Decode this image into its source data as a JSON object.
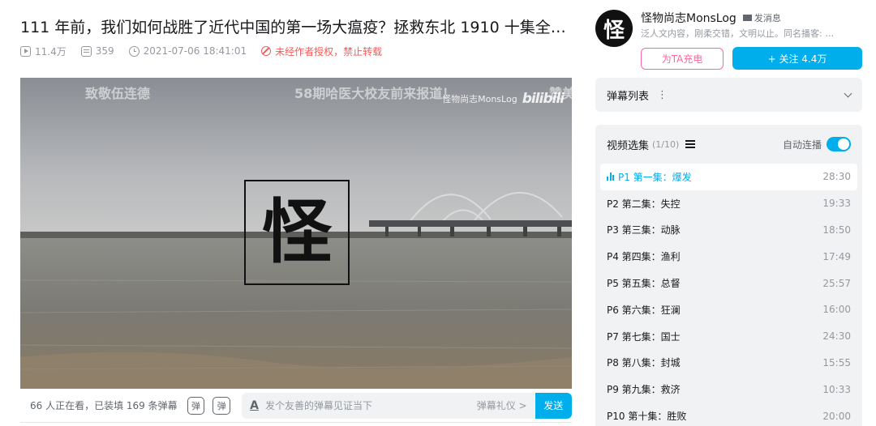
{
  "video": {
    "title": "111 年前，我们如何战胜了近代中国的第一场大瘟疫？拯救东北 1910 十集全【…",
    "views": "11.4万",
    "danmaku_count": "359",
    "publish_time": "2021-07-06 18:41:01",
    "copyright_notice": "未经作者授权，禁止转载"
  },
  "player": {
    "overlay_danmaku": [
      "致敬伍连德",
      "58期哈医大校友前来报道！",
      "赞美"
    ],
    "watermark_text": "怪物尚志MonsLog",
    "watermark_logo": "bilibili",
    "center_logo_char": "怪"
  },
  "send_bar": {
    "viewers_text": "66 人正在看，已装填 169 条弹幕",
    "toggle_danmaku_icon": "弹",
    "danmaku_settings_icon": "弹",
    "input_placeholder": "发个友善的弹幕见证当下",
    "etiquette_link": "弹幕礼仪 >",
    "send_label": "发送"
  },
  "uploader": {
    "avatar_char": "怪",
    "name": "怪物尚志MonsLog",
    "message_label": "发消息",
    "description": "泛人文内容，刚柔交错，文明以止。同名播客: …",
    "charge_label": "为TA充电",
    "follow_label": "+ 关注 4.4万"
  },
  "danmaku_list": {
    "label": "弹幕列表",
    "more": "⋮"
  },
  "episodes": {
    "header": "视频选集",
    "count": "(1/10)",
    "autoplay_label": "自动连播",
    "items": [
      {
        "label": "P1  第一集：爆发",
        "duration": "28:30"
      },
      {
        "label": "P2  第二集：失控",
        "duration": "19:33"
      },
      {
        "label": "P3  第三集：动脉",
        "duration": "18:50"
      },
      {
        "label": "P4  第四集：渔利",
        "duration": "17:49"
      },
      {
        "label": "P5  第五集：总督",
        "duration": "25:57"
      },
      {
        "label": "P6  第六集：狂澜",
        "duration": "16:00"
      },
      {
        "label": "P7  第七集：国士",
        "duration": "24:30"
      },
      {
        "label": "P8  第八集：封城",
        "duration": "15:55"
      },
      {
        "label": "P9  第九集：救济",
        "duration": "10:33"
      },
      {
        "label": "P10  第十集：胜败",
        "duration": "20:00"
      }
    ]
  },
  "colors": {
    "accent": "#00aeec",
    "charge_pink": "#ff6699",
    "warning_red": "#f25d5d"
  }
}
